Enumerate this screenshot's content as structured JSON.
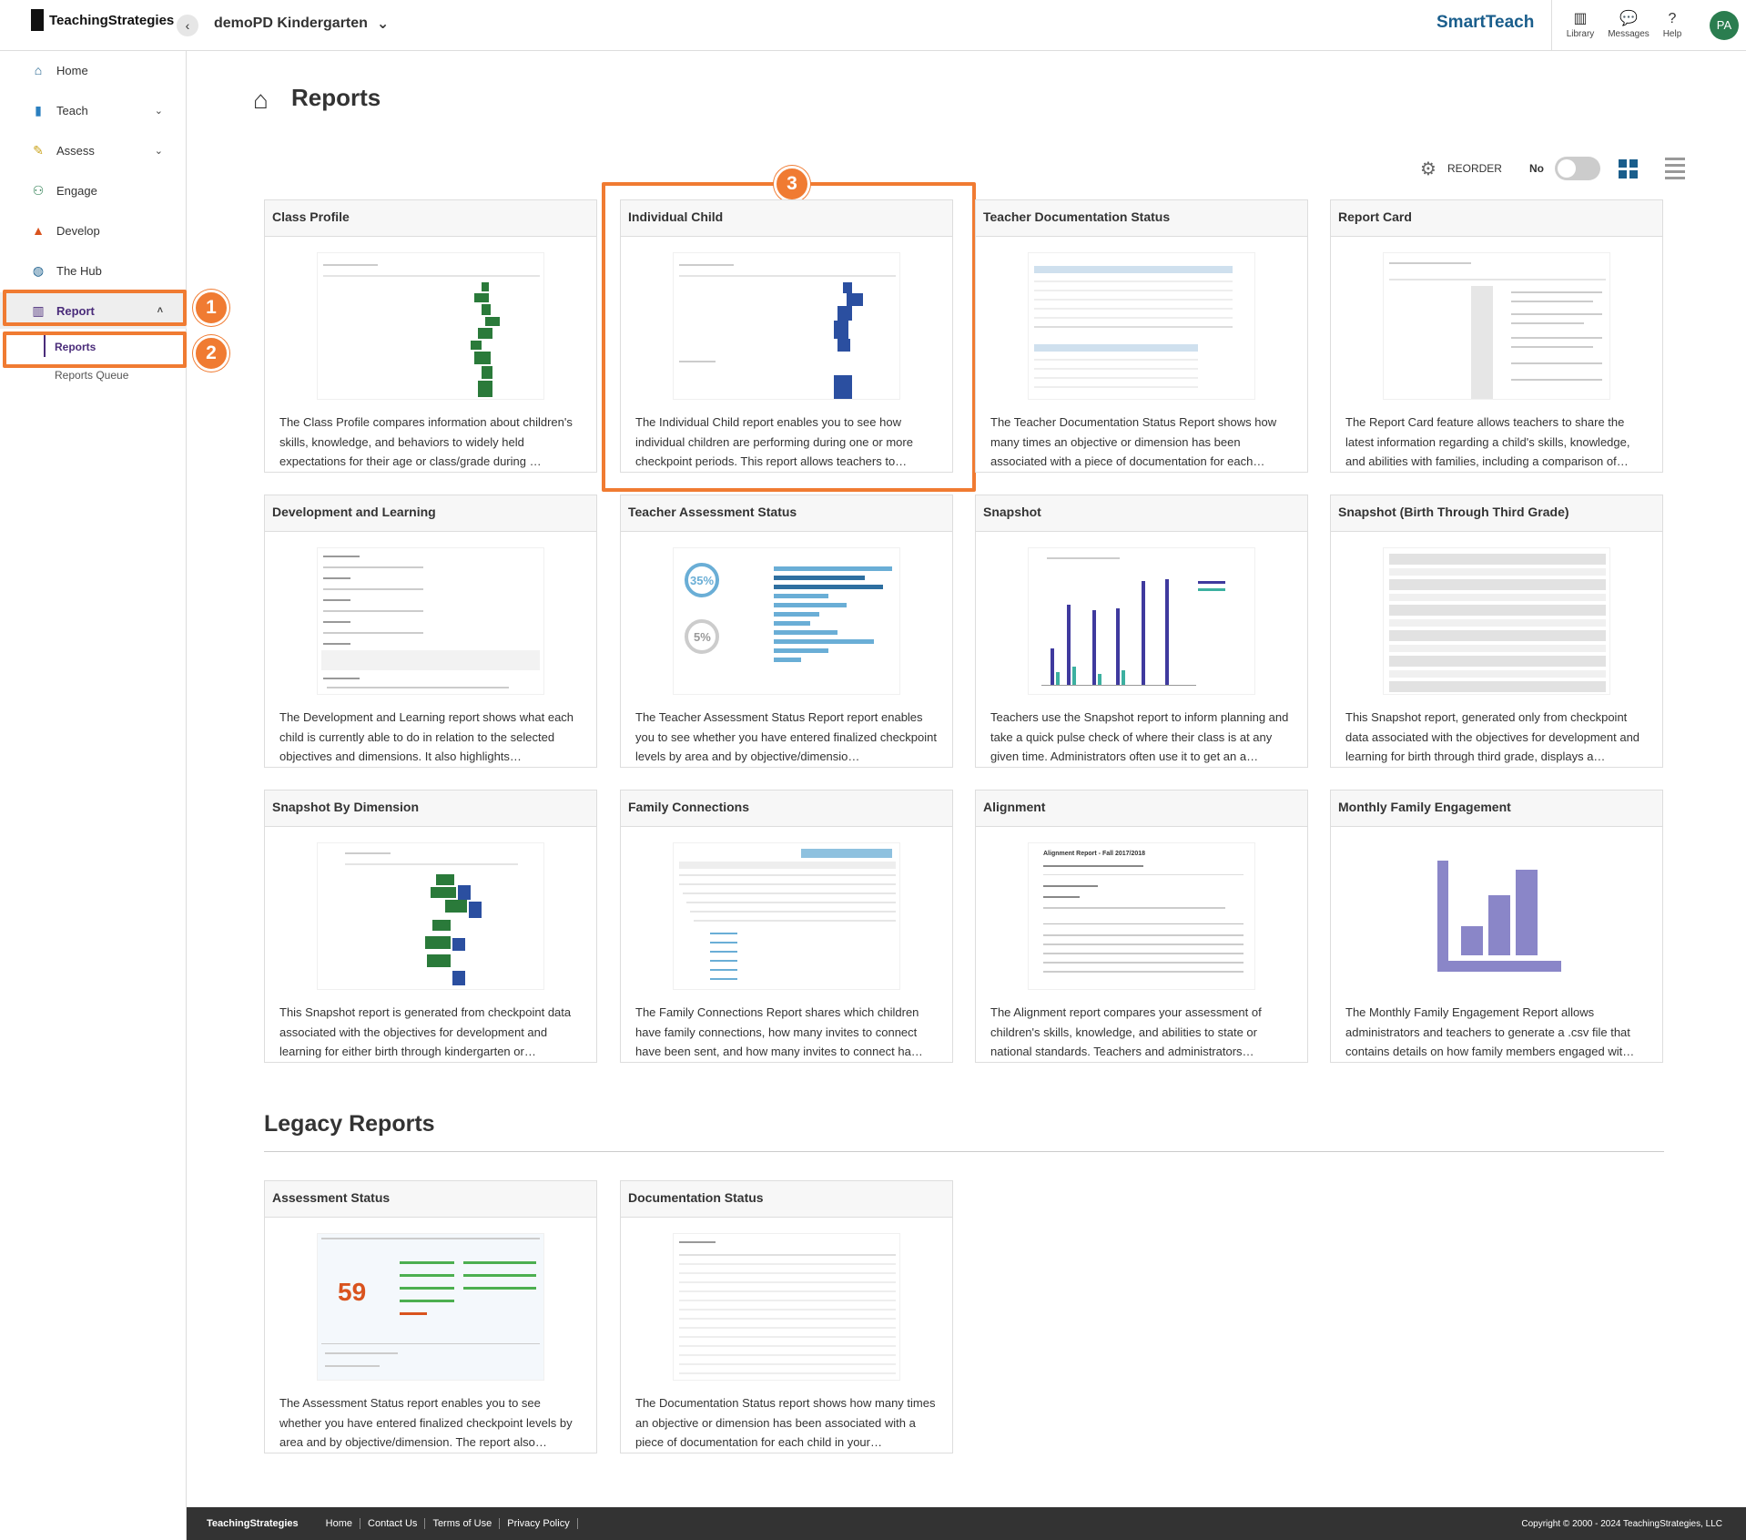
{
  "app": {
    "brand": "TeachingStrategies",
    "class_name": "demoPD Kindergarten",
    "product": "SmartTeach",
    "top_icons": [
      {
        "label": "Library",
        "icon": "library-icon"
      },
      {
        "label": "Messages",
        "icon": "messages-icon"
      },
      {
        "label": "Help",
        "icon": "help-icon"
      }
    ],
    "avatar_initials": "PA"
  },
  "sidebar": {
    "items": [
      {
        "label": "Home",
        "icon": "home-icon"
      },
      {
        "label": "Teach",
        "icon": "book-icon"
      },
      {
        "label": "Assess",
        "icon": "pencil-icon"
      },
      {
        "label": "Engage",
        "icon": "people-icon"
      },
      {
        "label": "Develop",
        "icon": "mortarboard-icon"
      },
      {
        "label": "The Hub",
        "icon": "globe-icon"
      },
      {
        "label": "Report",
        "icon": "chart-icon"
      }
    ],
    "subitems": [
      {
        "label": "Reports"
      },
      {
        "label": "Reports Queue"
      }
    ]
  },
  "markers": [
    "1",
    "2",
    "3"
  ],
  "main": {
    "title": "Reports",
    "reorder_label": "REORDER",
    "reorder_value": "No",
    "cards": [
      {
        "title": "Class Profile",
        "desc": "The Class Profile compares information about children's skills, knowledge, and behaviors to widely held expectations for their age or class/grade during …"
      },
      {
        "title": "Individual Child",
        "desc": "The Individual Child report enables you to see how individual children are performing during one or more checkpoint periods. This report allows teachers to…"
      },
      {
        "title": "Teacher Documentation Status",
        "desc": "The Teacher Documentation Status Report shows how many times an objective or dimension has been associated with a piece of documentation for each…"
      },
      {
        "title": "Report Card",
        "desc": "The Report Card feature allows teachers to share the latest information regarding a child's skills, knowledge, and abilities with families, including a comparison of…"
      },
      {
        "title": "Development and Learning",
        "desc": "The Development and Learning report shows what each child is currently able to do in relation to the selected objectives and dimensions. It also highlights…"
      },
      {
        "title": "Teacher Assessment Status",
        "desc": "The Teacher Assessment Status Report report enables you to see whether you have entered finalized checkpoint levels by area and by objective/dimensio…"
      },
      {
        "title": "Snapshot",
        "desc": "Teachers use the Snapshot report to inform planning and take a quick pulse check of where their class is at any given time. Administrators often use it to get an a…"
      },
      {
        "title": "Snapshot (Birth Through Third Grade)",
        "desc": "This Snapshot report, generated only from checkpoint data associated with the objectives for development and learning for birth through third grade, displays a…"
      },
      {
        "title": "Snapshot By Dimension",
        "desc": "This Snapshot report is generated from checkpoint data associated with the objectives for development and learning for either birth through kindergarten or…"
      },
      {
        "title": "Family Connections",
        "desc": "The Family Connections Report shares which children have family connections, how many invites to connect have been sent, and how many invites to connect ha…"
      },
      {
        "title": "Alignment",
        "desc": "The Alignment report compares your assessment of children's skills, knowledge, and abilities to state or national standards. Teachers and administrators…"
      },
      {
        "title": "Monthly Family Engagement",
        "desc": "The Monthly Family Engagement Report allows administrators and teachers to generate a .csv file that contains details on how family members engaged wit…"
      }
    ],
    "thumb_text": {
      "ta_pct1": "35%",
      "ta_pct2": "5%",
      "as_pct": "59",
      "align_title": "Alignment Report - Fall 2017/2018"
    }
  },
  "legacy": {
    "title": "Legacy Reports",
    "cards": [
      {
        "title": "Assessment Status",
        "desc": "The Assessment Status report enables you to see whether you have entered finalized checkpoint levels by area and by objective/dimension. The report also…"
      },
      {
        "title": "Documentation Status",
        "desc": "The Documentation Status report shows how many times an objective or dimension has been associated with a piece of documentation for each child in your…"
      }
    ]
  },
  "footer": {
    "brand": "TeachingStrategies",
    "links": [
      "Home",
      "Contact Us",
      "Terms of Use",
      "Privacy Policy"
    ],
    "copyright": "Copyright © 2000 - 2024 TeachingStrategies, LLC"
  },
  "colors": {
    "accent": "#f07b32",
    "brand_purple": "#4a2c7a",
    "footer_bg": "#333333",
    "smartteach_blue": "#1a5e8c"
  }
}
